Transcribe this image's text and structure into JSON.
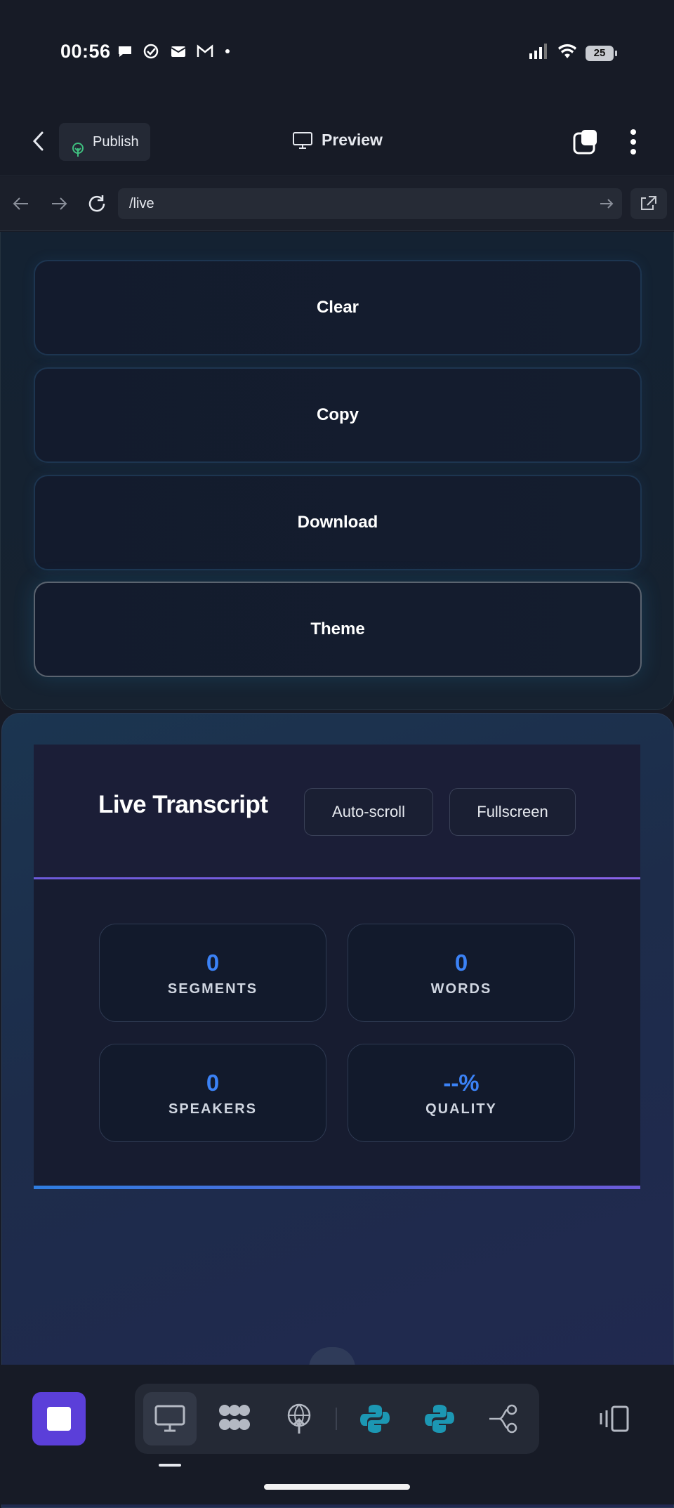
{
  "status_bar": {
    "time": "00:56",
    "battery": "25"
  },
  "app_bar": {
    "publish_label": "Publish",
    "preview_label": "Preview"
  },
  "url_bar": {
    "url": "/live"
  },
  "actions": {
    "clear": "Clear",
    "copy": "Copy",
    "download": "Download",
    "theme": "Theme"
  },
  "transcript": {
    "title": "Live Transcript",
    "autoscroll_label": "Auto-scroll",
    "fullscreen_label": "Fullscreen",
    "stats": [
      {
        "value": "0",
        "label": "SEGMENTS"
      },
      {
        "value": "0",
        "label": "WORDS"
      },
      {
        "value": "0",
        "label": "SPEAKERS"
      },
      {
        "value": "--%",
        "label": "QUALITY"
      }
    ]
  },
  "colors": {
    "accent": "#3b82f6",
    "stop": "#5b3fd9",
    "python": "#1c97b3"
  }
}
